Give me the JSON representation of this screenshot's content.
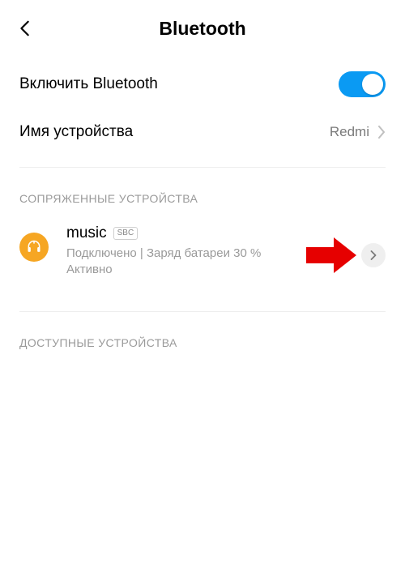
{
  "header": {
    "title": "Bluetooth"
  },
  "enable": {
    "label": "Включить Bluetooth",
    "on": true
  },
  "device_name": {
    "label": "Имя устройства",
    "value": "Redmi"
  },
  "sections": {
    "paired": "СОПРЯЖЕННЫЕ УСТРОЙСТВА",
    "available": "ДОСТУПНЫЕ УСТРОЙСТВА"
  },
  "paired_devices": [
    {
      "name": "music",
      "codec": "SBC",
      "status": "Подключено | Заряд батареи 30 % Активно"
    }
  ],
  "colors": {
    "accent": "#0a9af3",
    "device_icon_bg": "#f6a623",
    "callout_arrow": "#e60000"
  }
}
